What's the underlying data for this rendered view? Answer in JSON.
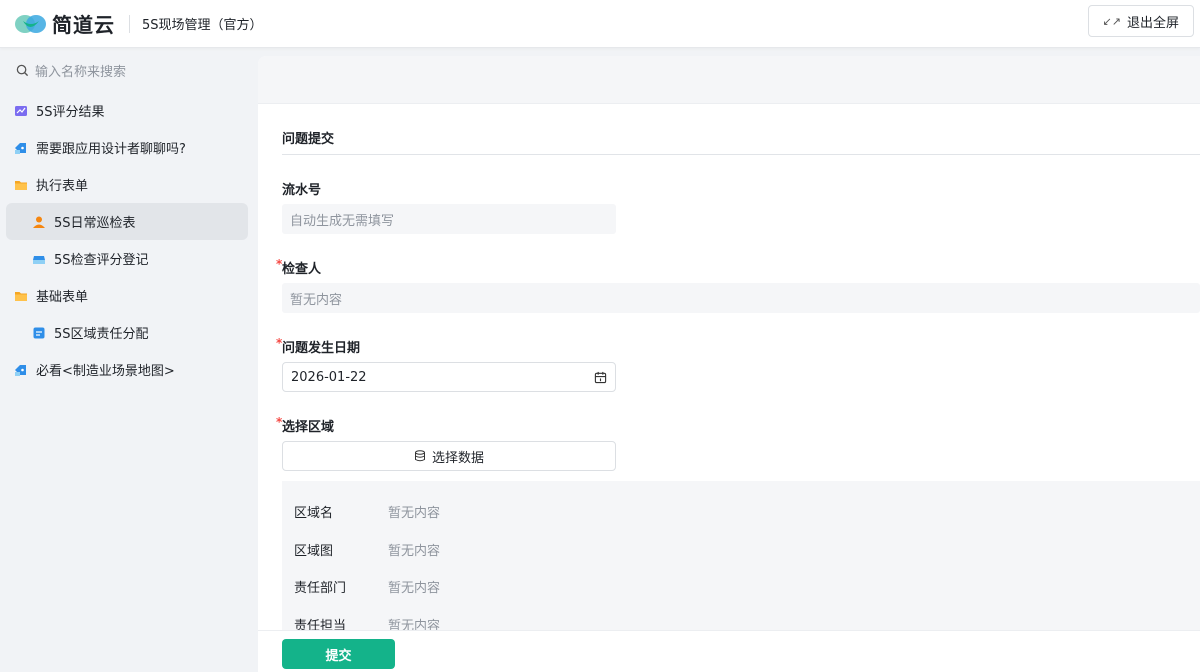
{
  "header": {
    "logo_text": "简道云",
    "app_title": "5S现场管理（官方）",
    "exit_fullscreen": "退出全屏",
    "brand_color": "#14b38a"
  },
  "sidebar": {
    "search_placeholder": "输入名称来搜索",
    "items": [
      {
        "label": "5S评分结果",
        "icon": "chart-report-icon",
        "level": 0
      },
      {
        "label": "需要跟应用设计者聊聊吗?",
        "icon": "chat-tag-icon",
        "level": 0
      },
      {
        "label": "执行表单",
        "icon": "folder-icon",
        "level": 0
      },
      {
        "label": "5S日常巡检表",
        "icon": "user-form-icon",
        "level": 1,
        "active": true
      },
      {
        "label": "5S检查评分登记",
        "icon": "inbox-icon",
        "level": 1
      },
      {
        "label": "基础表单",
        "icon": "folder-icon",
        "level": 0
      },
      {
        "label": "5S区域责任分配",
        "icon": "doc-form-icon",
        "level": 1
      },
      {
        "label": "必看<制造业场景地图>",
        "icon": "chat-tag-icon",
        "level": 0
      }
    ]
  },
  "form": {
    "section_title": "问题提交",
    "serial": {
      "label": "流水号",
      "placeholder": "自动生成无需填写"
    },
    "inspector": {
      "label": "检查人",
      "value": "暂无内容"
    },
    "date": {
      "label": "问题发生日期",
      "value": "2026-01-22"
    },
    "region": {
      "label": "选择区域",
      "select_label": "选择数据",
      "rows": [
        {
          "key": "区域名",
          "value": "暂无内容"
        },
        {
          "key": "区域图",
          "value": "暂无内容"
        },
        {
          "key": "责任部门",
          "value": "暂无内容"
        },
        {
          "key": "责任担当",
          "value": "暂无内容"
        }
      ]
    },
    "submit_label": "提交"
  }
}
